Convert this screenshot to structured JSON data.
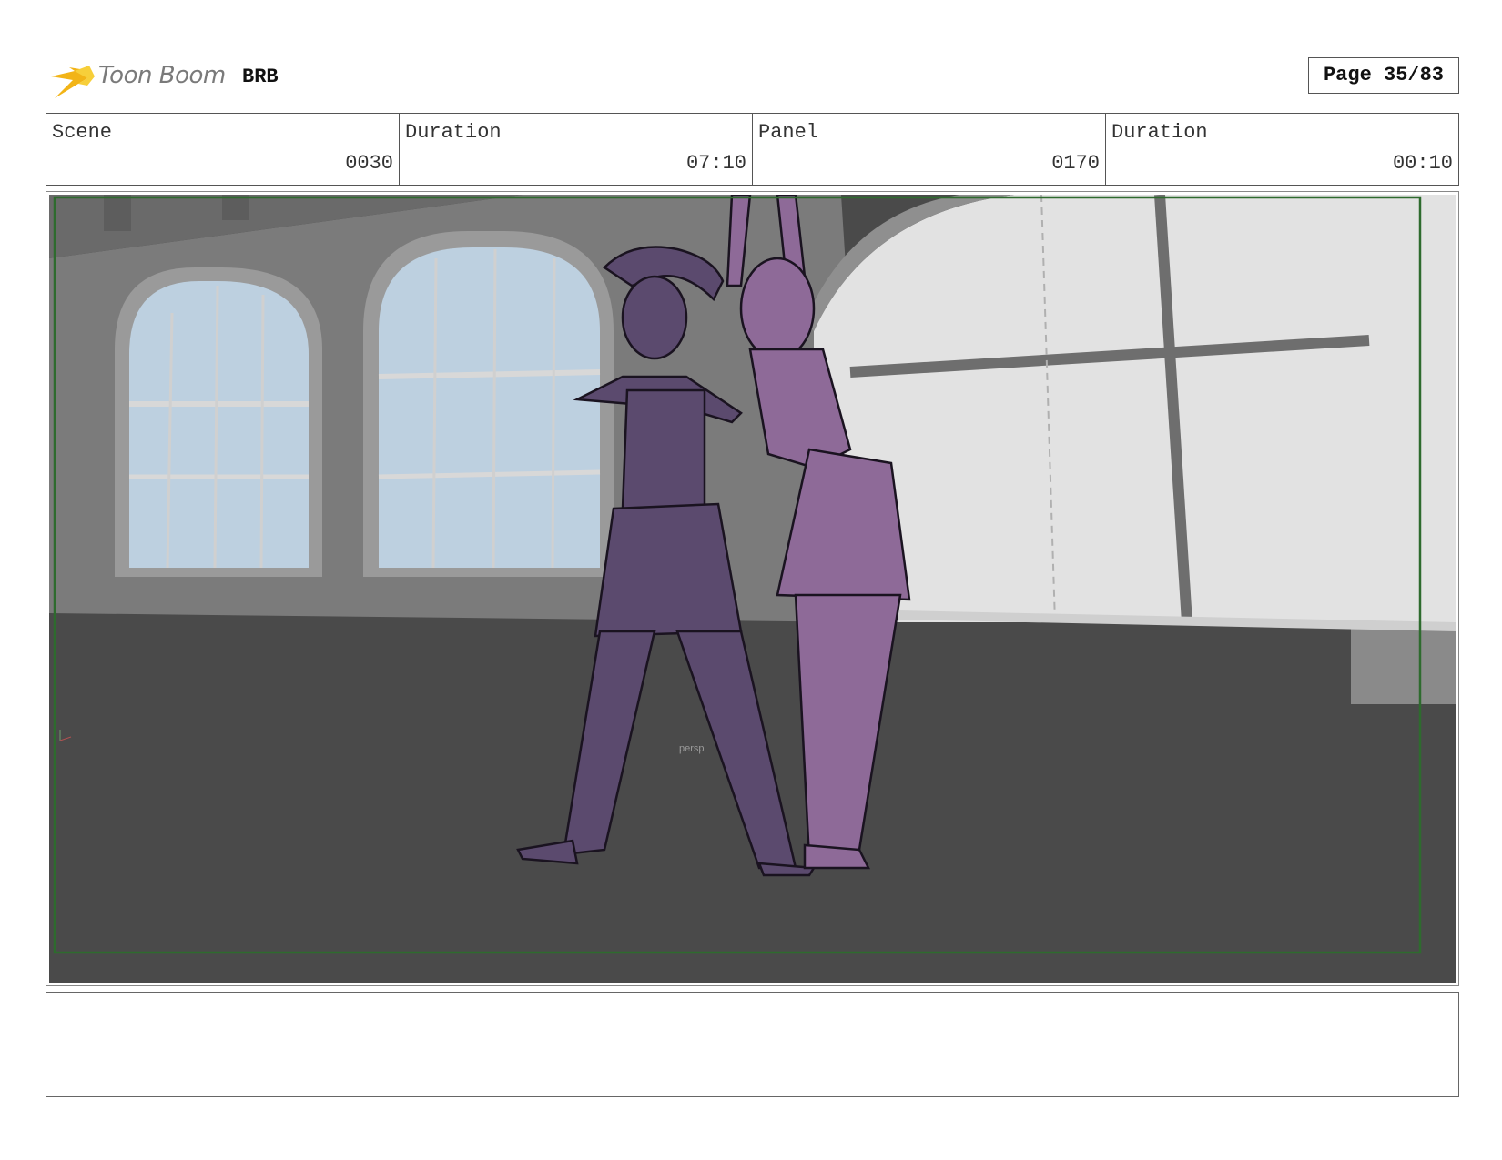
{
  "header": {
    "logo_text": "Toon Boom",
    "project": "BRB",
    "page_label": "Page 35/83"
  },
  "info": {
    "scene_label": "Scene",
    "scene_value": "0030",
    "scene_duration_label": "Duration",
    "scene_duration_value": "07:10",
    "panel_label": "Panel",
    "panel_value": "0170",
    "panel_duration_label": "Duration",
    "panel_duration_value": "00:10"
  },
  "panel": {
    "viewport_label": "persp",
    "colors": {
      "floor": "#4a4a4a",
      "wall": "#7b7b7b",
      "window_glass": "#bdd0e0",
      "big_window": "#e2e2e2",
      "girl_left": "#5b4a6e",
      "girl_right": "#8e6a98",
      "safe_frame": "#2e6b2e"
    }
  },
  "notes": {
    "text": ""
  }
}
